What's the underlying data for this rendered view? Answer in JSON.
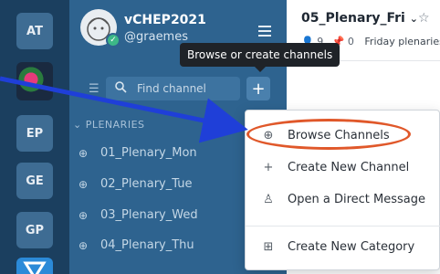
{
  "teams": {
    "items": [
      {
        "label": "AT"
      },
      {
        "label": ""
      },
      {
        "label": "EP"
      },
      {
        "label": "GE"
      },
      {
        "label": "GP"
      }
    ]
  },
  "sidebar": {
    "team_name": "vCHEP2021",
    "username": "@graemes",
    "tooltip": "Browse or create channels",
    "search_placeholder": "Find channel",
    "category": "PLENARIES",
    "channels": [
      {
        "name": "01_Plenary_Mon"
      },
      {
        "name": "02_Plenary_Tue"
      },
      {
        "name": "03_Plenary_Wed"
      },
      {
        "name": "04_Plenary_Thu"
      }
    ]
  },
  "header": {
    "channel_title": "05_Plenary_Fri",
    "member_count": "9",
    "pinned_count": "0",
    "description": "Friday plenaries"
  },
  "menu": {
    "items": [
      {
        "label": "Browse Channels",
        "icon": "globe-icon"
      },
      {
        "label": "Create New Channel",
        "icon": "plus-icon"
      },
      {
        "label": "Open a Direct Message",
        "icon": "person-plus-icon"
      },
      {
        "label": "Create New Category",
        "icon": "folder-plus-icon"
      }
    ]
  },
  "colors": {
    "team_sidebar": "#1b3f5f",
    "channel_sidebar": "#2e638f",
    "annotation_arrow": "#1f3fd8",
    "annotation_oval": "#e0582a"
  }
}
